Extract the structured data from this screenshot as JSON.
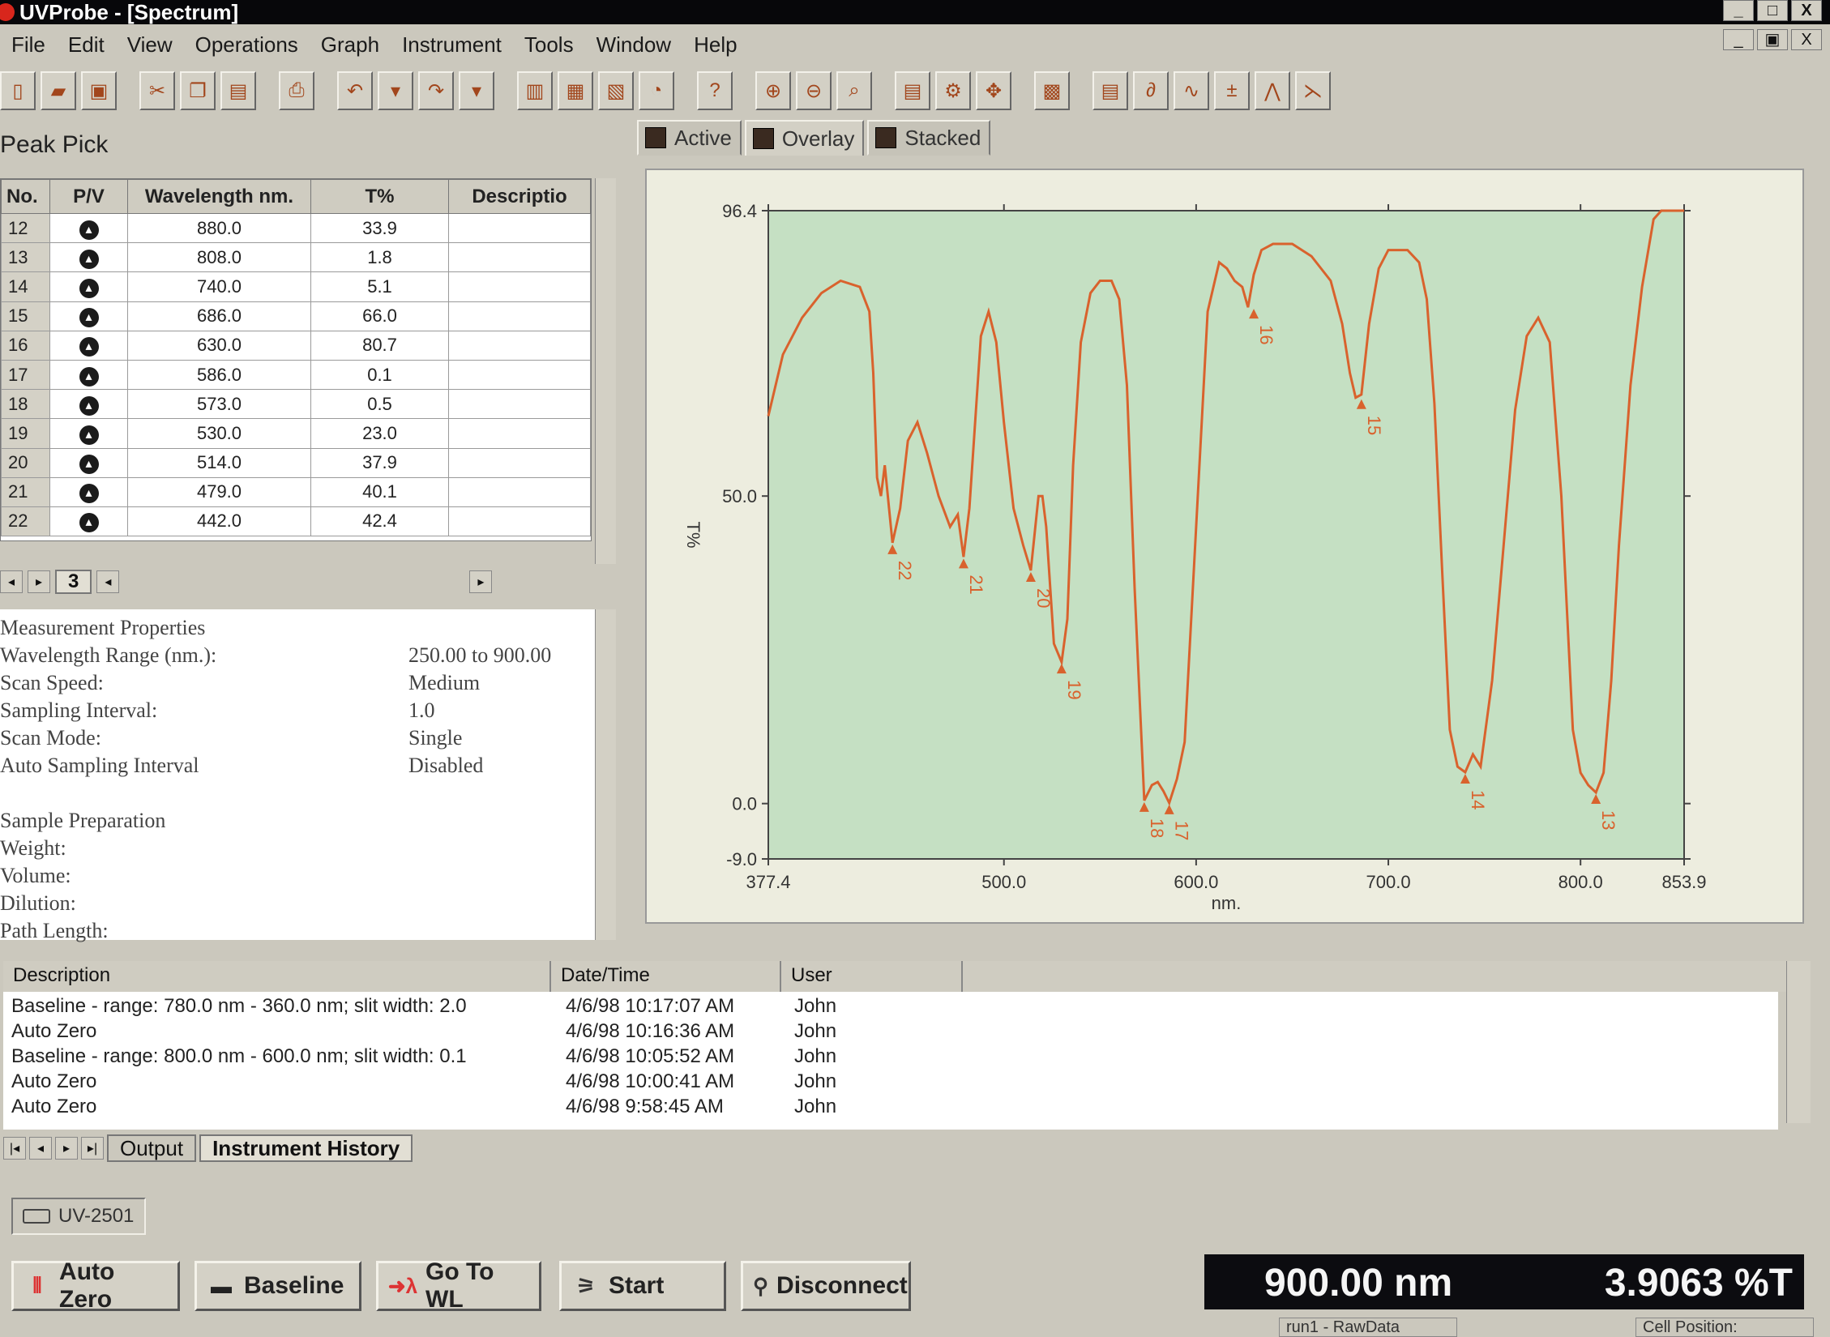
{
  "window": {
    "title": "UVProbe - [Spectrum]",
    "controls": [
      "_",
      "□",
      "X"
    ],
    "mdi_controls": [
      "_",
      "▣",
      "X"
    ]
  },
  "menu": [
    "File",
    "Edit",
    "View",
    "Operations",
    "Graph",
    "Instrument",
    "Tools",
    "Window",
    "Help"
  ],
  "peak_pick": {
    "title": "Peak Pick",
    "columns": [
      "No.",
      "P/V",
      "Wavelength nm.",
      "T%",
      "Descriptio"
    ],
    "rows": [
      {
        "no": "12",
        "wl": "880.0",
        "t": "33.9"
      },
      {
        "no": "13",
        "wl": "808.0",
        "t": "1.8"
      },
      {
        "no": "14",
        "wl": "740.0",
        "t": "5.1"
      },
      {
        "no": "15",
        "wl": "686.0",
        "t": "66.0"
      },
      {
        "no": "16",
        "wl": "630.0",
        "t": "80.7"
      },
      {
        "no": "17",
        "wl": "586.0",
        "t": "0.1"
      },
      {
        "no": "18",
        "wl": "573.0",
        "t": "0.5"
      },
      {
        "no": "19",
        "wl": "530.0",
        "t": "23.0"
      },
      {
        "no": "20",
        "wl": "514.0",
        "t": "37.9"
      },
      {
        "no": "21",
        "wl": "479.0",
        "t": "40.1"
      },
      {
        "no": "22",
        "wl": "442.0",
        "t": "42.4"
      }
    ],
    "sheet_tab": "3"
  },
  "properties": [
    {
      "label": "Measurement Properties",
      "value": ""
    },
    {
      "label": "Wavelength Range (nm.):",
      "value": "250.00 to 900.00"
    },
    {
      "label": "Scan Speed:",
      "value": "Medium"
    },
    {
      "label": "Sampling Interval:",
      "value": "1.0"
    },
    {
      "label": "Scan Mode:",
      "value": "Single"
    },
    {
      "label": "Auto Sampling Interval",
      "value": "Disabled"
    },
    {
      "label": "",
      "value": ""
    },
    {
      "label": "Sample Preparation",
      "value": ""
    },
    {
      "label": "Weight:",
      "value": ""
    },
    {
      "label": "Volume:",
      "value": ""
    },
    {
      "label": "Dilution:",
      "value": ""
    },
    {
      "label": "Path Length:",
      "value": ""
    }
  ],
  "graph_tabs": [
    "Active",
    "Overlay",
    "Stacked"
  ],
  "chart_data": {
    "type": "line",
    "xlabel": "nm.",
    "ylabel": "T%",
    "xlim": [
      377.4,
      853.9
    ],
    "ylim": [
      -9.0,
      96.4
    ],
    "xticks": [
      "377.4",
      "500.0",
      "600.0",
      "700.0",
      "800.0",
      "853.9"
    ],
    "xtick_values": [
      377.4,
      500.0,
      600.0,
      700.0,
      800.0,
      853.9
    ],
    "yticks": [
      "96.4",
      "50.0",
      "0.0",
      "-9.0"
    ],
    "ytick_values": [
      96.4,
      50.0,
      0.0,
      -9.0
    ],
    "line_color": "#d9622d",
    "plot_bg": "#c5e0c3",
    "series": [
      {
        "x": [
          377.4,
          385,
          395,
          405,
          415,
          425,
          430,
          432,
          434,
          436,
          438,
          442,
          446,
          450,
          455,
          460,
          466,
          472,
          476,
          479,
          482,
          485,
          488,
          492,
          496,
          500,
          505,
          510,
          514,
          516,
          518,
          520,
          522,
          526,
          530,
          533,
          536,
          540,
          545,
          550,
          556,
          560,
          564,
          568,
          573,
          577,
          580,
          583,
          586,
          590,
          594,
          600,
          606,
          612,
          616,
          620,
          624,
          627,
          630,
          634,
          640,
          650,
          660,
          670,
          676,
          680,
          683,
          686,
          690,
          695,
          700,
          710,
          716,
          720,
          724,
          728,
          732,
          736,
          740,
          744,
          748,
          754,
          760,
          766,
          772,
          778,
          784,
          790,
          796,
          800,
          804,
          808,
          812,
          816,
          820,
          826,
          832,
          838,
          842,
          846,
          850,
          853.9
        ],
        "y": [
          63,
          73,
          79,
          83,
          85,
          84,
          80,
          70,
          53,
          50,
          55,
          42.4,
          48,
          59,
          62,
          57,
          50,
          45,
          47,
          40.1,
          48,
          62,
          76,
          80,
          75,
          62,
          48,
          42,
          37.9,
          44,
          50,
          50,
          45,
          26,
          23.0,
          30,
          55,
          75,
          83,
          85,
          85,
          82,
          68,
          35,
          0.5,
          3,
          3.5,
          2,
          0.1,
          4,
          10,
          45,
          80,
          88,
          87,
          85,
          84,
          80.7,
          86,
          90,
          91,
          91,
          89,
          85,
          78,
          70,
          66.0,
          66.5,
          78,
          87,
          90,
          90,
          88,
          82,
          65,
          38,
          12,
          6,
          5.1,
          8,
          6,
          20,
          42,
          64,
          76,
          79,
          75,
          50,
          12,
          5,
          3,
          1.8,
          5,
          20,
          42,
          68,
          84,
          95,
          96.4,
          96.4,
          96.4,
          96.4
        ]
      }
    ],
    "peaks": [
      {
        "label": "13",
        "x": 808.0,
        "y": 1.8
      },
      {
        "label": "14",
        "x": 740.0,
        "y": 5.1
      },
      {
        "label": "15",
        "x": 686.0,
        "y": 66.0
      },
      {
        "label": "16",
        "x": 630.0,
        "y": 80.7
      },
      {
        "label": "17",
        "x": 586.0,
        "y": 0.1
      },
      {
        "label": "18",
        "x": 573.0,
        "y": 0.5
      },
      {
        "label": "19",
        "x": 530.0,
        "y": 23.0
      },
      {
        "label": "20",
        "x": 514.0,
        "y": 37.9
      },
      {
        "label": "21",
        "x": 479.0,
        "y": 40.1
      },
      {
        "label": "22",
        "x": 442.0,
        "y": 42.4
      }
    ]
  },
  "history": {
    "columns": [
      "Description",
      "Date/Time",
      "User"
    ],
    "rows": [
      {
        "desc": "Baseline - range: 780.0 nm - 360.0 nm; slit width: 2.0",
        "date": "4/6/98 10:17:07 AM",
        "user": "John"
      },
      {
        "desc": "Auto Zero",
        "date": "4/6/98 10:16:36 AM",
        "user": "John"
      },
      {
        "desc": "Baseline - range: 800.0 nm - 600.0 nm; slit width: 0.1",
        "date": "4/6/98 10:05:52 AM",
        "user": "John"
      },
      {
        "desc": "Auto Zero",
        "date": "4/6/98 10:00:41 AM",
        "user": "John"
      },
      {
        "desc": "Auto Zero",
        "date": "4/6/98 9:58:45 AM",
        "user": "John"
      }
    ],
    "tabs": [
      "Output",
      "Instrument History"
    ]
  },
  "instrument": {
    "name": "UV-2501"
  },
  "buttons": {
    "auto_zero": "Auto Zero",
    "baseline": "Baseline",
    "goto_wl": "Go To WL",
    "start": "Start",
    "disconnect": "Disconnect"
  },
  "readout": {
    "wavelength": "900.00 nm",
    "value": "3.9063 %T"
  },
  "status": {
    "file": "run1 - RawData",
    "cell": "Cell Position:"
  }
}
